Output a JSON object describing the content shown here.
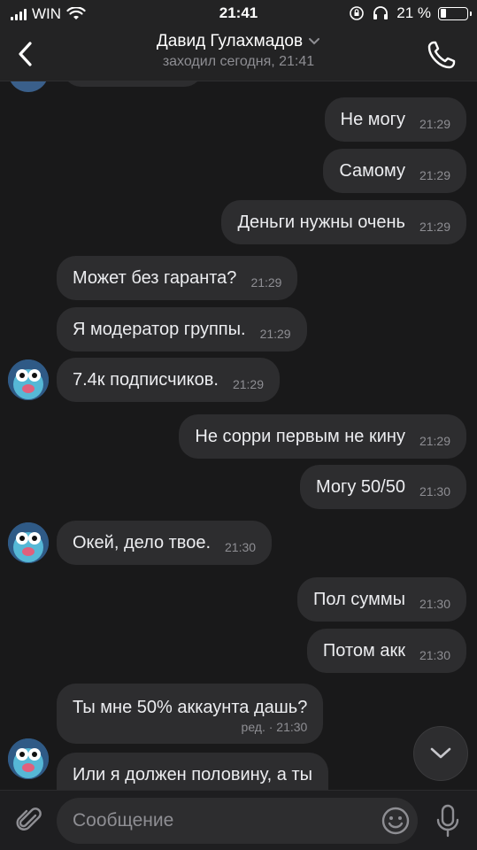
{
  "status_bar": {
    "carrier": "WIN",
    "time": "21:41",
    "battery": "21 %",
    "battery_fraction": 0.21
  },
  "header": {
    "name": "Давид Гулахмадов",
    "status": "заходил сегодня, 21:41"
  },
  "messages": [
    {
      "dir": "out",
      "text": "Не могу",
      "time": "21:29"
    },
    {
      "dir": "out",
      "text": "Самому",
      "time": "21:29"
    },
    {
      "dir": "out",
      "text": "Деньги нужны очень",
      "time": "21:29"
    },
    {
      "dir": "in",
      "text": "Может без гаранта?",
      "time": "21:29"
    },
    {
      "dir": "in",
      "text": "Я модератор группы.",
      "time": "21:29"
    },
    {
      "dir": "in",
      "text": "7.4к подписчиков.",
      "time": "21:29"
    },
    {
      "dir": "out",
      "text": "Не сорри первым не кину",
      "time": "21:29"
    },
    {
      "dir": "out",
      "text": "Могу 50/50",
      "time": "21:30"
    },
    {
      "dir": "in",
      "text": "Окей, дело твое.",
      "time": "21:30"
    },
    {
      "dir": "out",
      "text": "Пол суммы",
      "time": "21:30"
    },
    {
      "dir": "out",
      "text": "Потом акк",
      "time": "21:30"
    },
    {
      "dir": "in",
      "text": "Ты мне 50% аккаунта дашь?",
      "time": "ред. · 21:30"
    },
    {
      "dir": "in",
      "text": "Или я должен половину, а ты",
      "time": ""
    }
  ],
  "composer": {
    "placeholder": "Сообщение"
  },
  "icons": {
    "back": "chevron-left-icon",
    "call": "phone-icon",
    "title_arrow": "chevron-down-icon",
    "scroll": "chevron-down-icon",
    "attach": "paperclip-icon",
    "emoji": "smiley-icon",
    "mic": "microphone-icon"
  },
  "colors": {
    "background": "#19191a",
    "bubble": "#2d2d2f",
    "header": "#232324",
    "secondary_text": "#8e8e93"
  }
}
